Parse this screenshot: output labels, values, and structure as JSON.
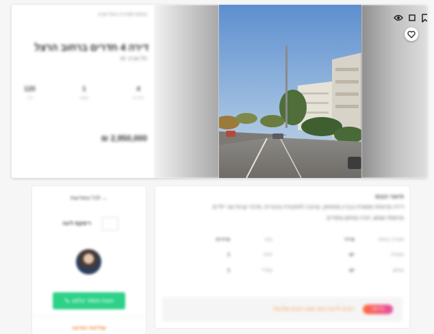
{
  "listing": {
    "breadcrumb": "נכסים למכירה בתל אביב",
    "title": "דירה 4 חדרים ברחוב הרצל",
    "subtitle": "תל אביב יפו",
    "stats": [
      {
        "value": "120",
        "label": "מ\"ר"
      },
      {
        "value": "1",
        "label": "קומה"
      },
      {
        "value": "4",
        "label": "חדרים"
      }
    ],
    "price": "2,950,000 ₪"
  },
  "gallery": {
    "icons": [
      "eye-icon",
      "square-icon",
      "bookmark-icon",
      "heart-icon"
    ]
  },
  "agent": {
    "back_link": "← לכל המודעות",
    "agency_name": "רימקס ליגה",
    "phone_button": "הצגת מספר טלפון",
    "contact_link": "שליחת הודעה"
  },
  "description": {
    "heading": "תיאור הנכס",
    "line1": "דירה מרווחת ומוארת בבניין מתוחזק, קרובה לתחבורה ציבורית, מרכזי קניות וגני ילדים",
    "line2": "מרפסת שמש, חניה ומחסן צמודים",
    "rows": [
      {
        "a": "תאריך כניסה",
        "b": "מיידי",
        "c": "נכס",
        "d": "מיידית"
      },
      {
        "a": "מעלית",
        "b": "יש",
        "c": "חניה",
        "d": "1"
      },
      {
        "a": "מחסן",
        "b": "יש",
        "c": "ממ\"ד",
        "d": "1"
      }
    ],
    "promo_text": "רוצים לדעת כמה שווה הנכס שלכם?",
    "promo_pill": "בדיקה"
  },
  "colors": {
    "accent_green": "#2ed188",
    "accent_orange": "#f08a3c"
  }
}
